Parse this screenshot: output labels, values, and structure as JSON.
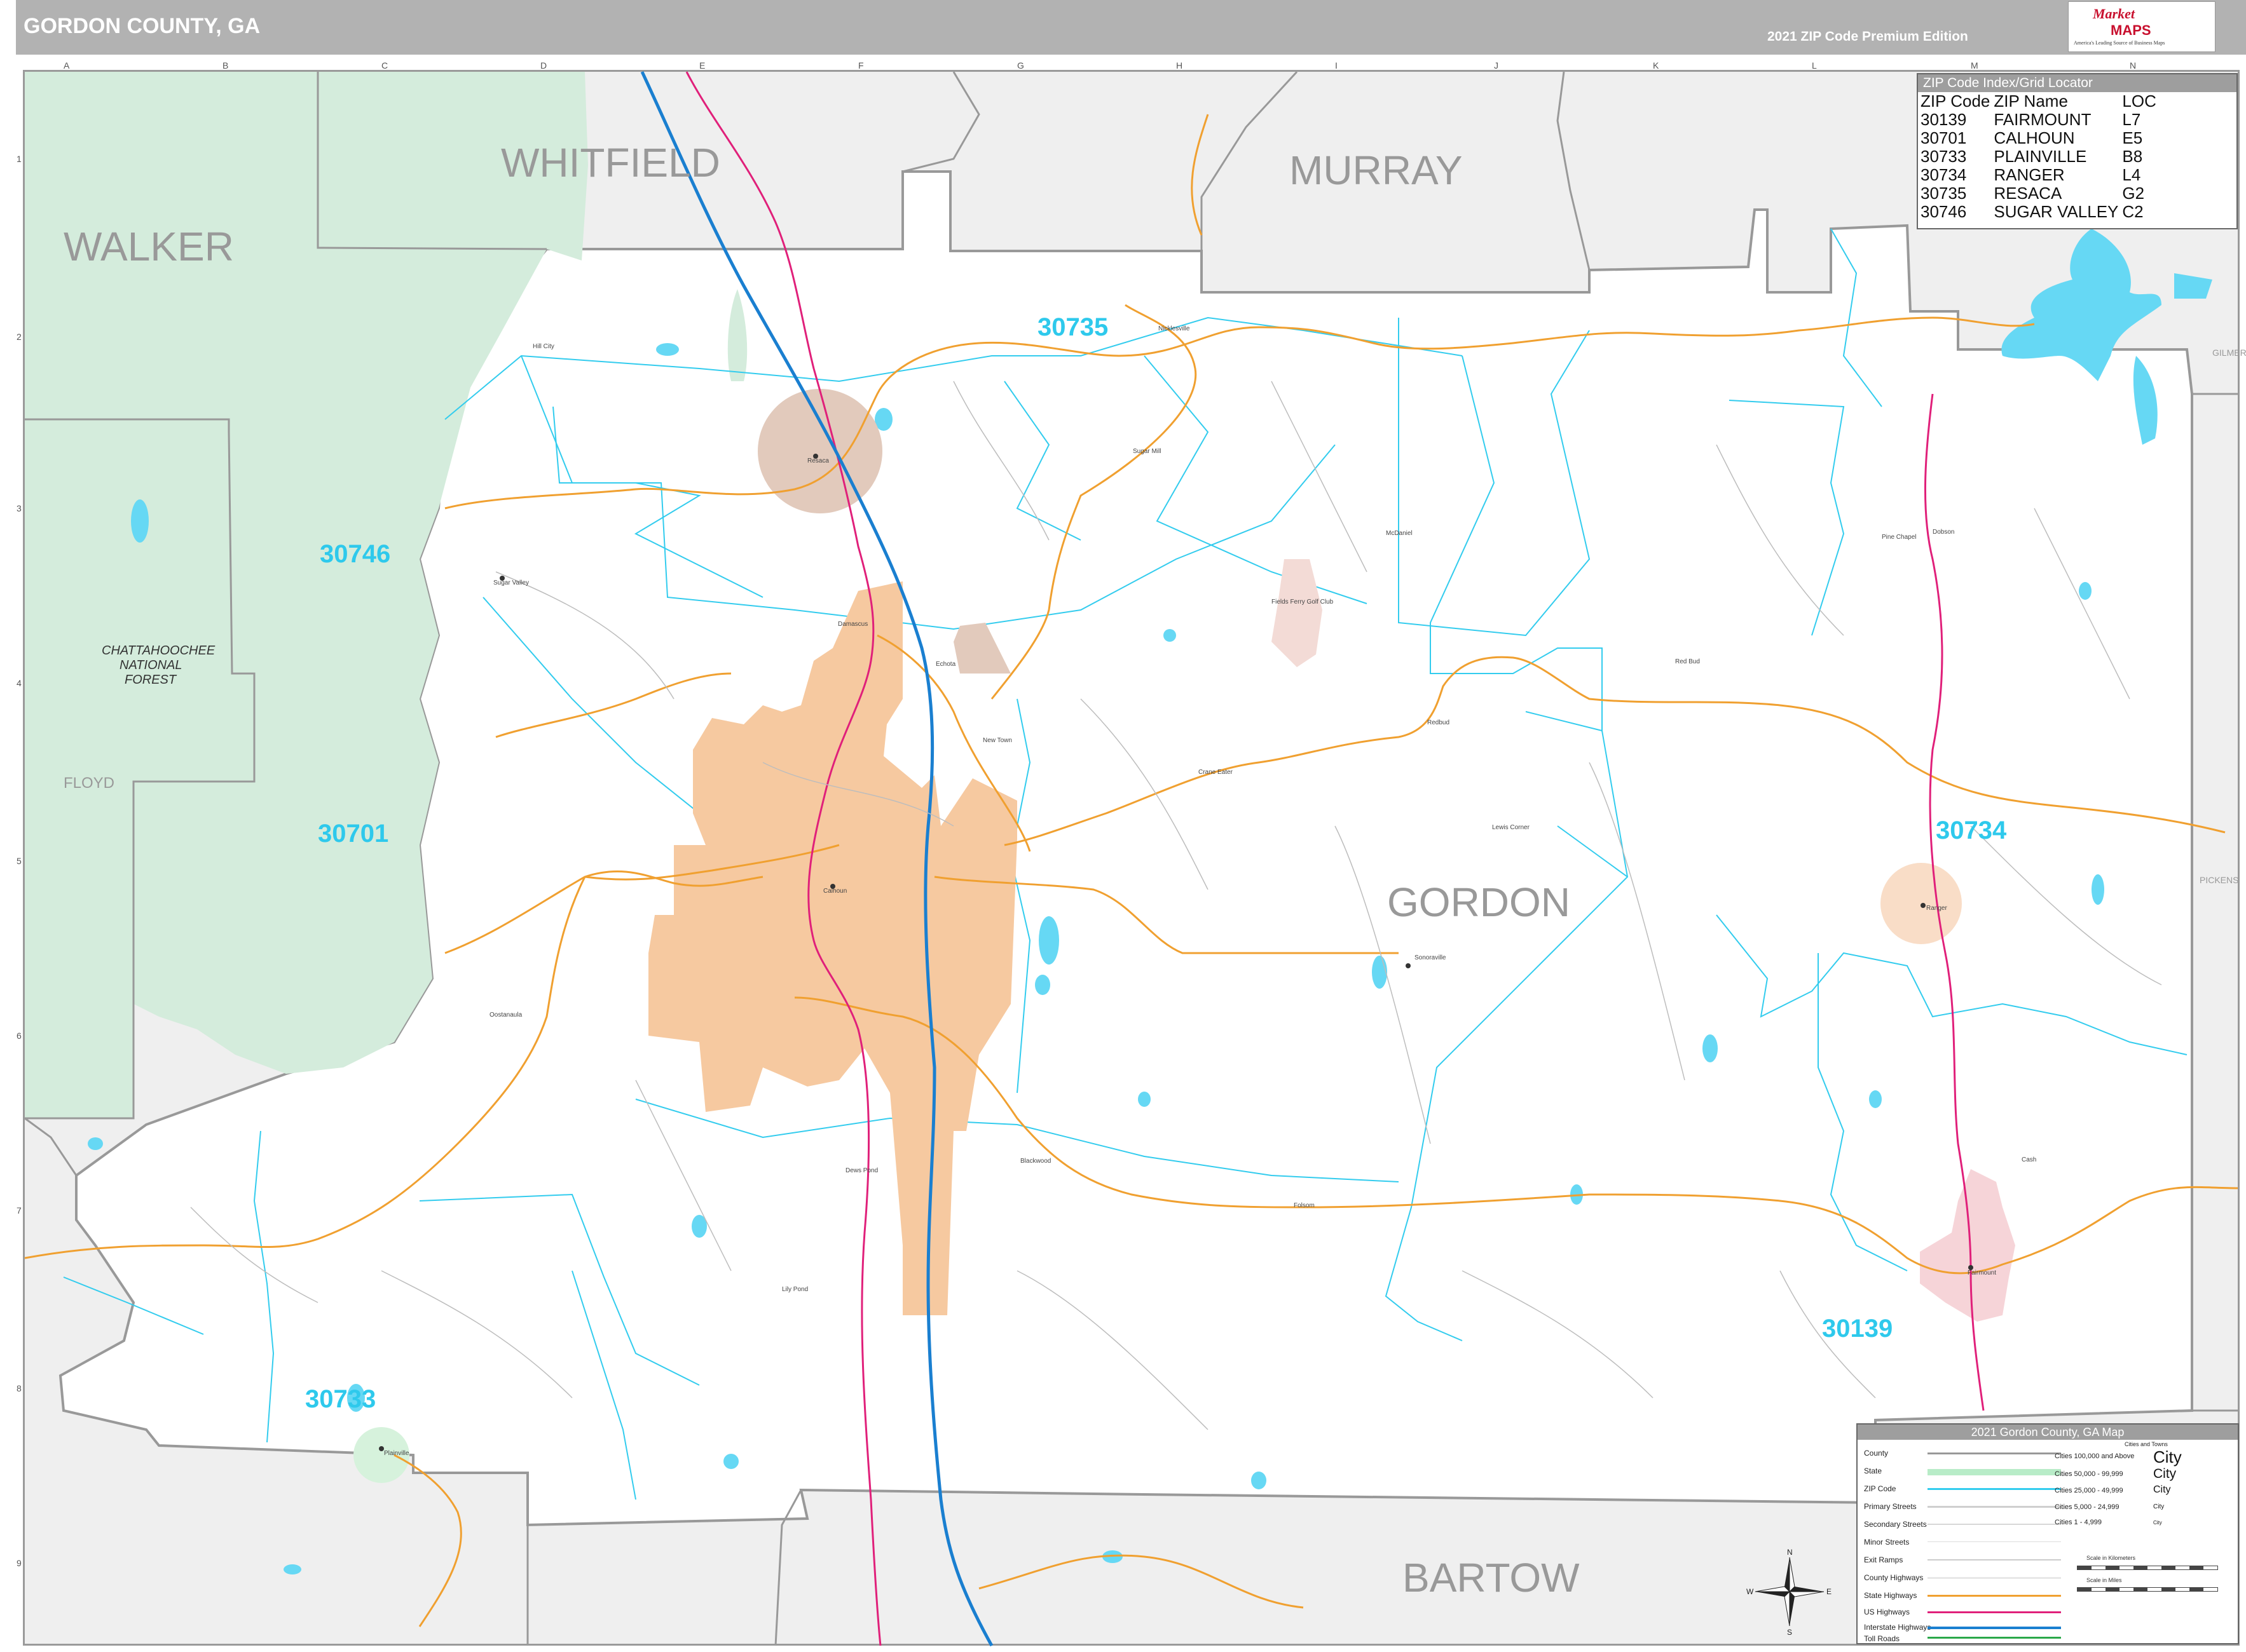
{
  "header": {
    "title": "GORDON COUNTY, GA",
    "edition": "2021 ZIP Code Premium Edition",
    "logo_market": "Market",
    "logo_maps": "MAPS",
    "logo_tagline": "America's Leading Source of Business Maps"
  },
  "grid": {
    "letters": [
      "A",
      "B",
      "C",
      "D",
      "E",
      "F",
      "G",
      "H",
      "I",
      "J",
      "K",
      "L",
      "M",
      "N"
    ],
    "numbers": [
      "1",
      "2",
      "3",
      "4",
      "5",
      "6",
      "7",
      "8",
      "9"
    ]
  },
  "counties": {
    "walker": "WALKER",
    "whitfield": "WHITFIELD",
    "murray": "MURRAY",
    "gordon": "GORDON",
    "bartow": "BARTOW",
    "floyd": "FLOYD",
    "pickens": "PICKENS",
    "gilmer": "GILMER"
  },
  "forest_label": [
    "CHATTAHOOCHEE",
    "NATIONAL",
    "FOREST"
  ],
  "zip_labels": {
    "z30735": "30735",
    "z30746": "30746",
    "z30701": "30701",
    "z30734": "30734",
    "z30139": "30139",
    "z30733": "30733"
  },
  "places": {
    "resaca": "Resaca",
    "calhoun": "Calhoun",
    "ranger": "Ranger",
    "fairmount": "Fairmount",
    "plainville": "Plainville",
    "sugar_valley": "Sugar Valley",
    "sonoraville": "Sonoraville",
    "oostanaula": "Oostanaula",
    "dews_pond": "Dews Pond",
    "lily_pond": "Lily Pond",
    "redbud": "Redbud",
    "nicklesville": "Nicklesville",
    "hill_city": "Hill City",
    "sugar_mill": "Sugar Mill",
    "red_bud": "Red Bud",
    "lewis_corner": "Lewis Corner",
    "echota": "Echota",
    "plainville_rd": "Folsom",
    "mcdaniel": "McDaniel",
    "damascus": "Damascus",
    "new_town": "New Town",
    "cash": "Cash",
    "fields_ferry": "Fields Ferry Golf Club",
    "blackwood": "Blackwood",
    "pine_chapel": "Pine Chapel",
    "crane_eater": "Crane Eater",
    "dobson": "Dobson"
  },
  "zip_index": {
    "title": "ZIP Code Index/Grid Locator",
    "columns": [
      "ZIP Code",
      "ZIP Name",
      "LOC"
    ],
    "rows": [
      [
        "30139",
        "FAIRMOUNT",
        "L7"
      ],
      [
        "30701",
        "CALHOUN",
        "E5"
      ],
      [
        "30733",
        "PLAINVILLE",
        "B8"
      ],
      [
        "30734",
        "RANGER",
        "L4"
      ],
      [
        "30735",
        "RESACA",
        "G2"
      ],
      [
        "30746",
        "SUGAR VALLEY",
        "C2"
      ]
    ]
  },
  "legend": {
    "title": "2021 Gordon County, GA Map",
    "items": [
      "County",
      "State",
      "ZIP Code",
      "Primary Streets",
      "Secondary Streets",
      "Minor Streets",
      "Exit Ramps",
      "County Highways",
      "State Highways",
      "US Highways",
      "Interstate Highways",
      "Toll Roads"
    ],
    "cities_header": "Cities and Towns",
    "city_classes": [
      "Cities 100,000 and Above",
      "Cities 50,000 - 99,999",
      "Cities 25,000 - 49,999",
      "Cities 5,000 - 24,999",
      "Cities 1 - 4,999"
    ],
    "city_samples": [
      "City",
      "City",
      "City",
      "City",
      "City"
    ],
    "scale_km": "Scale in Kilometers",
    "scale_mi": "Scale in Miles"
  },
  "compass": {
    "n": "N",
    "s": "S",
    "e": "E",
    "w": "W"
  },
  "colors": {
    "forest": "#d4ecdc",
    "outside": "#efefef",
    "zip_boundary": "#33ccee",
    "county_boundary": "#999999",
    "state_highway": "#f0a030",
    "us_highway": "#e0207a",
    "interstate": "#1a7fd0",
    "water": "#66d8f4",
    "calhoun_area": "#f6c9a0"
  }
}
